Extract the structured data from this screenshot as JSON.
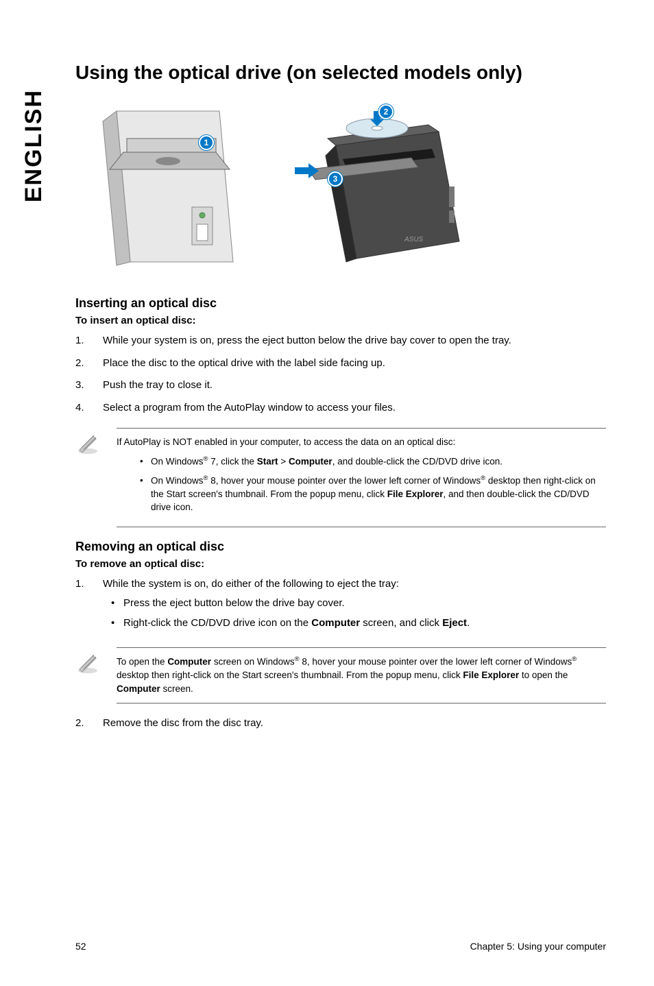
{
  "side_tab": "ENGLISH",
  "h1": "Using the optical drive (on selected models only)",
  "callouts": {
    "c1": "1",
    "c2": "2",
    "c3": "3"
  },
  "insert": {
    "heading": "Inserting an optical disc",
    "sub": "To insert an optical disc:",
    "steps": [
      {
        "n": "1.",
        "t": "While your system is on, press the eject button below the drive bay cover to open the tray."
      },
      {
        "n": "2.",
        "t": "Place the disc to the optical drive with the label side facing up."
      },
      {
        "n": "3.",
        "t": "Push the tray to close it."
      },
      {
        "n": "4.",
        "t": "Select a program from the AutoPlay window to access your files."
      }
    ]
  },
  "note1": {
    "intro": "If AutoPlay is NOT enabled in your computer, to access the data on an optical disc:",
    "b1_pre": "On Windows",
    "b1_mid": " 7, click the ",
    "b1_start": "Start",
    "b1_gt": " > ",
    "b1_computer": "Computer",
    "b1_post": ", and double-click the CD/DVD drive icon.",
    "b2_pre": "On Windows",
    "b2_mid": " 8, hover your mouse pointer over the lower left corner of Windows",
    "b2_post1": " desktop then right-click on the Start screen's thumbnail. From the popup menu, click ",
    "b2_fe": "File Explorer",
    "b2_post2": ", and then double-click the CD/DVD drive icon."
  },
  "remove": {
    "heading": "Removing an optical disc",
    "sub": "To remove an optical disc:",
    "step1_n": "1.",
    "step1_t": "While the system is on, do either of the following to eject the tray:",
    "sub1": "Press the eject button below the drive bay cover.",
    "sub2_pre": "Right-click the CD/DVD drive icon on the ",
    "sub2_comp": "Computer",
    "sub2_mid": " screen, and click ",
    "sub2_eject": "Eject",
    "sub2_post": ".",
    "step2_n": "2.",
    "step2_t": "Remove the disc from the disc tray."
  },
  "note2": {
    "pre": "To open the ",
    "comp1": "Computer",
    "mid1": " screen on Windows",
    "mid2": " 8, hover your mouse pointer over the lower left corner of Windows",
    "mid3": " desktop then right-click on the Start screen's thumbnail. From the popup menu, click ",
    "fe": "File Explorer",
    "mid4": " to open the ",
    "comp2": "Computer",
    "post": " screen."
  },
  "footer": {
    "page": "52",
    "chapter": "Chapter 5: Using your computer"
  },
  "reg": "®"
}
